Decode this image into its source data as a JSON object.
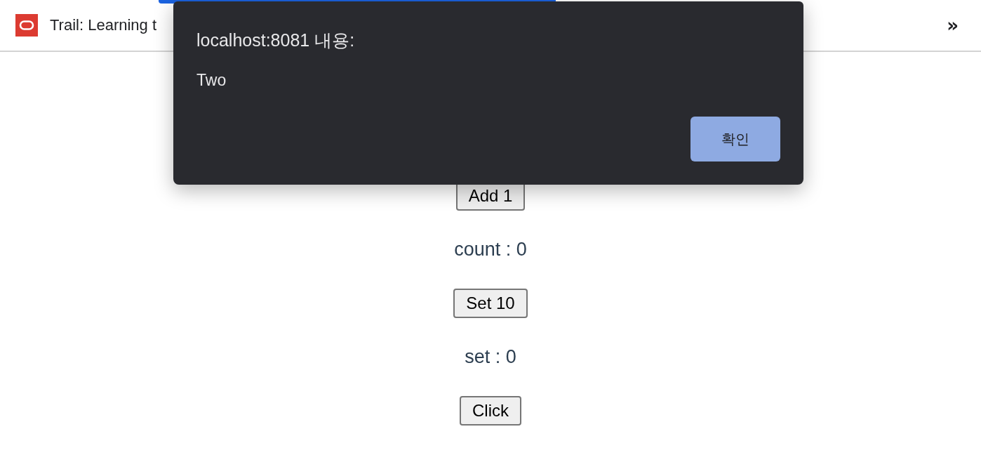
{
  "bookmarks_bar": {
    "items": [
      {
        "label": "Trail: Learning t"
      }
    ],
    "overflow": "»"
  },
  "dialog": {
    "title": "localhost:8081 내용:",
    "message": "Two",
    "button": "확인"
  },
  "page": {
    "items": [
      {
        "kind": "button",
        "label": "Add 1"
      },
      {
        "kind": "text",
        "label": "count : 0"
      },
      {
        "kind": "button",
        "label": "Set 10"
      },
      {
        "kind": "text",
        "label": "set : 0"
      },
      {
        "kind": "button",
        "label": "Click"
      }
    ]
  }
}
